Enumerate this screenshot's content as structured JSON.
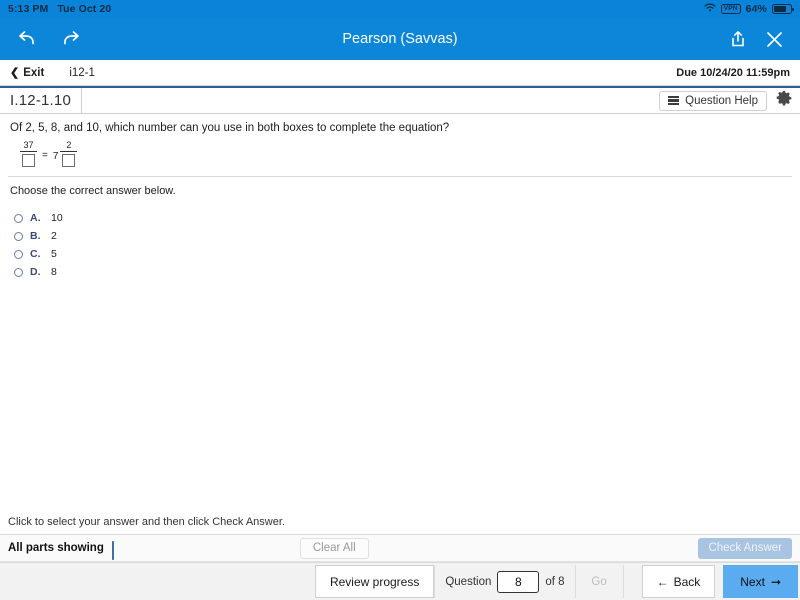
{
  "statusbar": {
    "time": "5:13 PM",
    "date": "Tue Oct 20",
    "wifi_icon": "wifi-icon",
    "vpn_label": "VPN",
    "battery_percent": "64%",
    "battery_icon": "battery-icon"
  },
  "toolbar": {
    "back_icon": "back-arrow-icon",
    "forward_icon": "forward-arrow-icon",
    "title": "Pearson (Savvas)",
    "share_icon": "share-icon",
    "close_icon": "close-icon",
    "background_color": "#0b86d9"
  },
  "subbar": {
    "exit_label": "Exit",
    "back_chevron_icon": "chevron-left-icon",
    "assignment_id": "i12-1",
    "due_text": "Due 10/24/20 11:59pm"
  },
  "question_strip": {
    "question_id": "I.12-1.10",
    "help_label": "Question Help",
    "help_icon": "list-icon",
    "settings_icon": "gear-icon"
  },
  "question": {
    "prompt": "Of 2, 5, 8, and 10, which number can you use in both boxes to complete the equation?",
    "equation": {
      "left_numerator": "37",
      "left_denominator": "",
      "equals": "=",
      "whole_number": "7",
      "right_numerator": "2",
      "right_denominator": ""
    },
    "instruction": "Choose the correct answer below.",
    "choices": [
      {
        "letter": "A.",
        "value": "10",
        "selected": false
      },
      {
        "letter": "B.",
        "value": "2",
        "selected": false
      },
      {
        "letter": "C.",
        "value": "5",
        "selected": false
      },
      {
        "letter": "D.",
        "value": "8",
        "selected": false
      }
    ]
  },
  "footer": {
    "hint": "Click to select your answer and then click Check Answer.",
    "parts_label": "All parts showing",
    "progress_percent": 100,
    "progress_color": "#4a80c0",
    "clear_all_label": "Clear All",
    "check_answer_label": "Check Answer",
    "check_answer_color": "#a9c4e0"
  },
  "navbar": {
    "review_label": "Review progress",
    "question_label": "Question",
    "question_value": "8",
    "of_label": "of 8",
    "go_label": "Go",
    "back_label": "Back",
    "back_icon": "arrow-left-icon",
    "next_label": "Next",
    "next_icon": "arrow-right-icon",
    "next_color": "#5aabf0"
  }
}
